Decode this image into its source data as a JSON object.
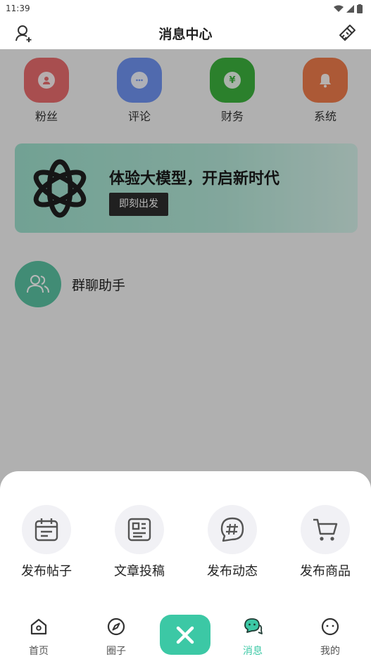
{
  "status_bar": {
    "time": "11:39"
  },
  "header": {
    "title": "消息中心"
  },
  "quick_actions": [
    {
      "label": "粉丝",
      "color": "#e96c6e",
      "icon": "user-plus-icon"
    },
    {
      "label": "评论",
      "color": "#6f93f2",
      "icon": "chat-bubble-icon"
    },
    {
      "label": "财务",
      "color": "#3cb23e",
      "icon": "yen-coin-icon"
    },
    {
      "label": "系统",
      "color": "#ef7c4c",
      "icon": "bell-icon"
    }
  ],
  "banner": {
    "title": "体验大模型，开启新时代",
    "button": "即刻出发",
    "icon": "openai-logo-icon"
  },
  "chats": [
    {
      "name": "群聊助手",
      "icon": "group-icon",
      "color": "#5bc3a3"
    }
  ],
  "publish_sheet": {
    "items": [
      {
        "label": "发布帖子",
        "icon": "calendar-note-icon"
      },
      {
        "label": "文章投稿",
        "icon": "article-icon"
      },
      {
        "label": "发布动态",
        "icon": "hashtag-bubble-icon"
      },
      {
        "label": "发布商品",
        "icon": "shopping-cart-icon"
      }
    ]
  },
  "tabbar": {
    "tabs": [
      {
        "label": "首页",
        "icon": "home-icon"
      },
      {
        "label": "圈子",
        "icon": "compass-icon"
      },
      {
        "label": "消息",
        "icon": "message-icon",
        "active": true
      },
      {
        "label": "我的",
        "icon": "face-icon"
      }
    ],
    "close_icon": "close-icon",
    "accent": "#3cc8a5"
  }
}
